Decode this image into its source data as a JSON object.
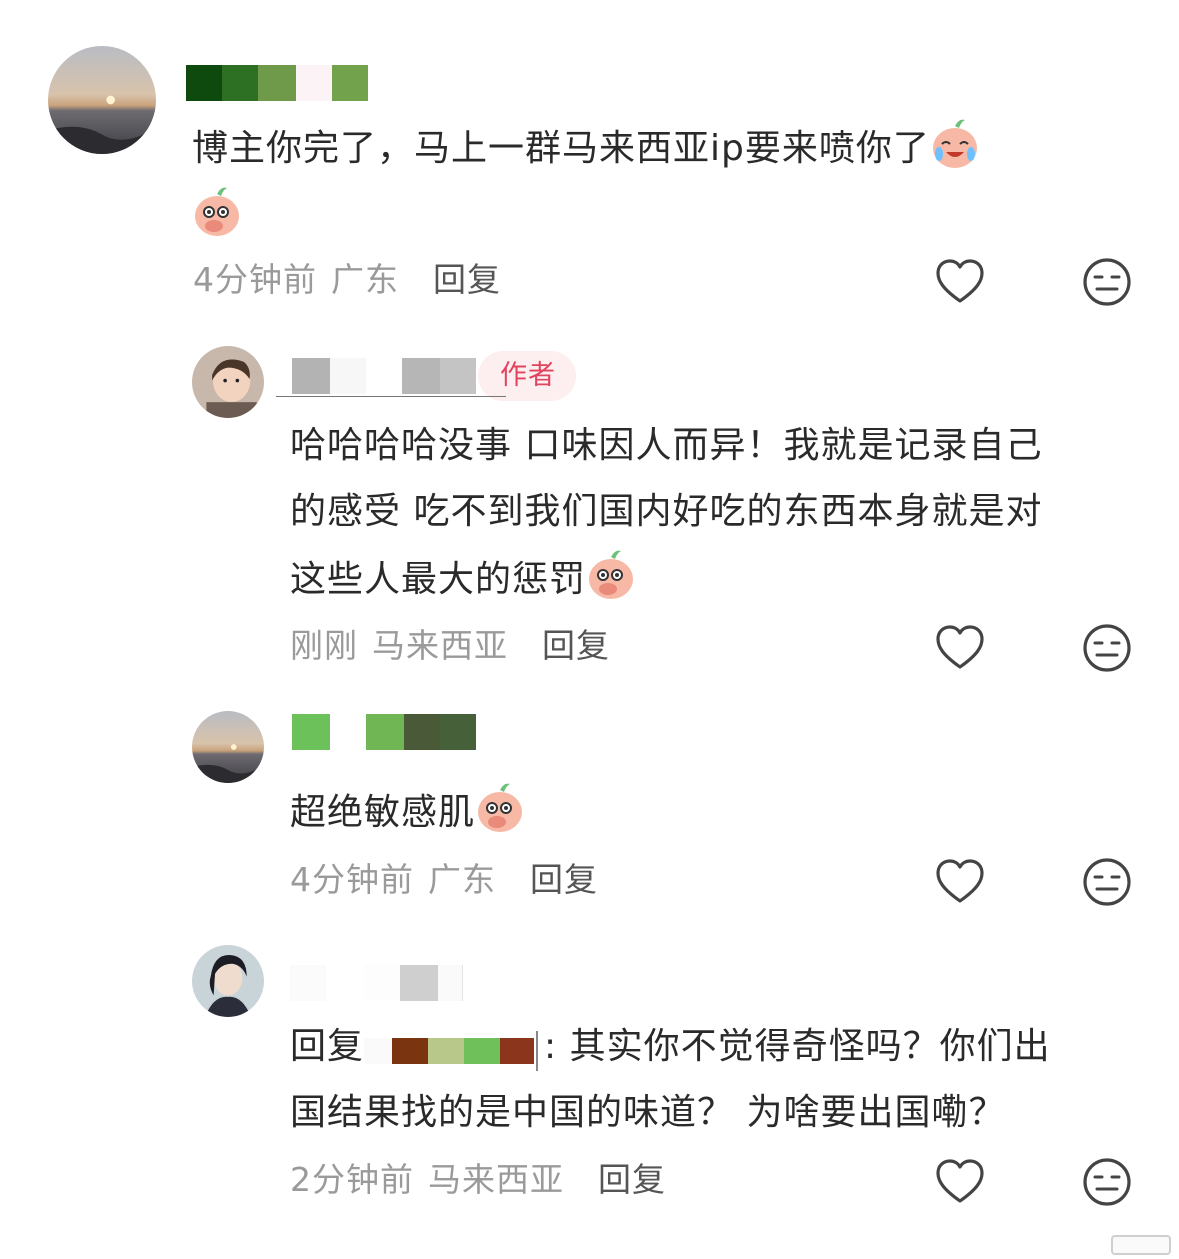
{
  "comments": [
    {
      "text": "博主你完了，马上一群马来西亚ip要来喷你了",
      "time": "4分钟前",
      "location": "广东",
      "reply_label": "回复"
    },
    {
      "author_tag": "作者",
      "text_line1": "哈哈哈哈没事 口味因人而异！我就是记录自己",
      "text_line2": "的感受 吃不到我们国内好吃的东西本身就是对",
      "text_line3": "这些人最大的惩罚",
      "time": "刚刚",
      "location": "马来西亚",
      "reply_label": "回复"
    },
    {
      "text": "超绝敏感肌",
      "time": "4分钟前",
      "location": "广东",
      "reply_label": "回复"
    },
    {
      "reply_prefix": "回复",
      "text_line1": ": 其实你不觉得奇怪吗？你们出",
      "text_line2": "国结果找的是中国的味道？ 为啥要出国嘞？",
      "time": "2分钟前",
      "location": "马来西亚",
      "reply_label": "回复"
    }
  ],
  "icons": {
    "like": "heart-outline-icon",
    "dislike": "neutral-face-icon",
    "emoji_crying_laugh": "peach-crying-laugh-emoji",
    "emoji_cover_mouth": "peach-cover-mouth-emoji"
  },
  "colors": {
    "author_tag_text": "#e0445e",
    "author_tag_bg": "#fdeef0",
    "meta_text": "#9a9a9a"
  }
}
